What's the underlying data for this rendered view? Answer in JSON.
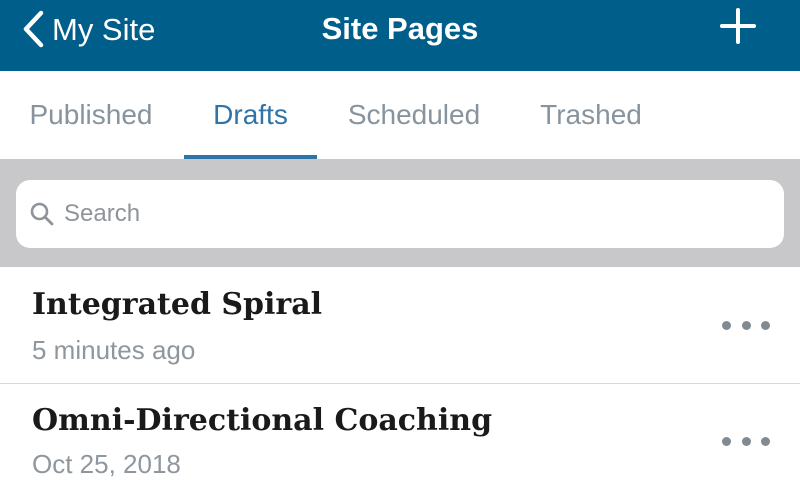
{
  "navbar": {
    "back_label": "My Site",
    "title": "Site Pages",
    "back_icon": "chevron-left-icon",
    "add_icon": "plus-icon",
    "background_color": "#005e8b"
  },
  "tabs": {
    "items": [
      {
        "label": "Published",
        "active": false
      },
      {
        "label": "Drafts",
        "active": true
      },
      {
        "label": "Scheduled",
        "active": false
      },
      {
        "label": "Trashed",
        "active": false
      }
    ],
    "active_color": "#2f74a8",
    "inactive_color": "#87949e"
  },
  "search": {
    "placeholder": "Search",
    "value": "",
    "icon": "search-icon"
  },
  "pages": [
    {
      "title": "Integrated Spiral",
      "subtitle": "5 minutes ago",
      "more_icon": "more-horizontal-icon"
    },
    {
      "title": "Omni-Directional Coaching",
      "subtitle": "Oct 25, 2018",
      "more_icon": "more-horizontal-icon"
    }
  ]
}
